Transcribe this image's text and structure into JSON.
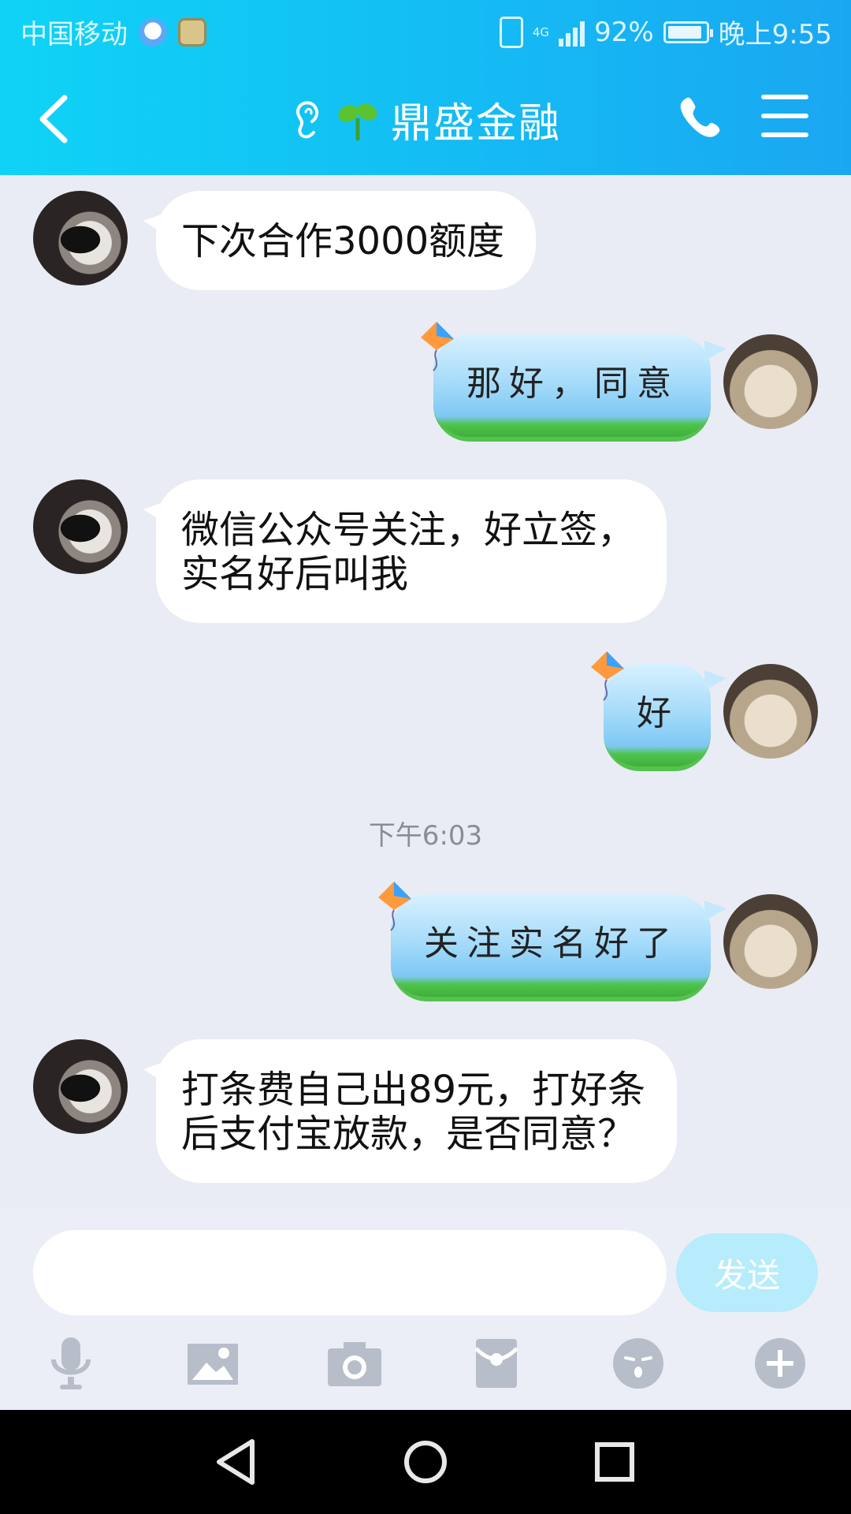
{
  "status_bar": {
    "carrier": "中国移动",
    "network": "4G",
    "battery": "92%",
    "time": "晚上9:55"
  },
  "header": {
    "title": "鼎盛金融"
  },
  "messages": [
    {
      "from": "other",
      "text": "下次合作3000额度"
    },
    {
      "from": "self",
      "text": "那好，同意"
    },
    {
      "from": "other",
      "line1": "微信公众号关注，好立签，",
      "line2": "实名好后叫我"
    },
    {
      "from": "self",
      "text": "好"
    },
    {
      "from": "self",
      "text": "关注实名好了"
    },
    {
      "from": "other",
      "line1": "打条费自己出89元，打好条",
      "line2": "后支付宝放款，是否同意？"
    }
  ],
  "timestamp": "下午6:03",
  "composer": {
    "input_value": "",
    "send_label": "发送"
  },
  "toolbar": [
    "mic-icon",
    "image-icon",
    "camera-icon",
    "red-packet-icon",
    "emoji-icon",
    "plus-icon"
  ],
  "colors": {
    "header_start": "#0fd3f6",
    "header_end": "#1aa7f2",
    "chat_background": "#e9ecf4",
    "send_disabled": "#b6ecfb"
  }
}
